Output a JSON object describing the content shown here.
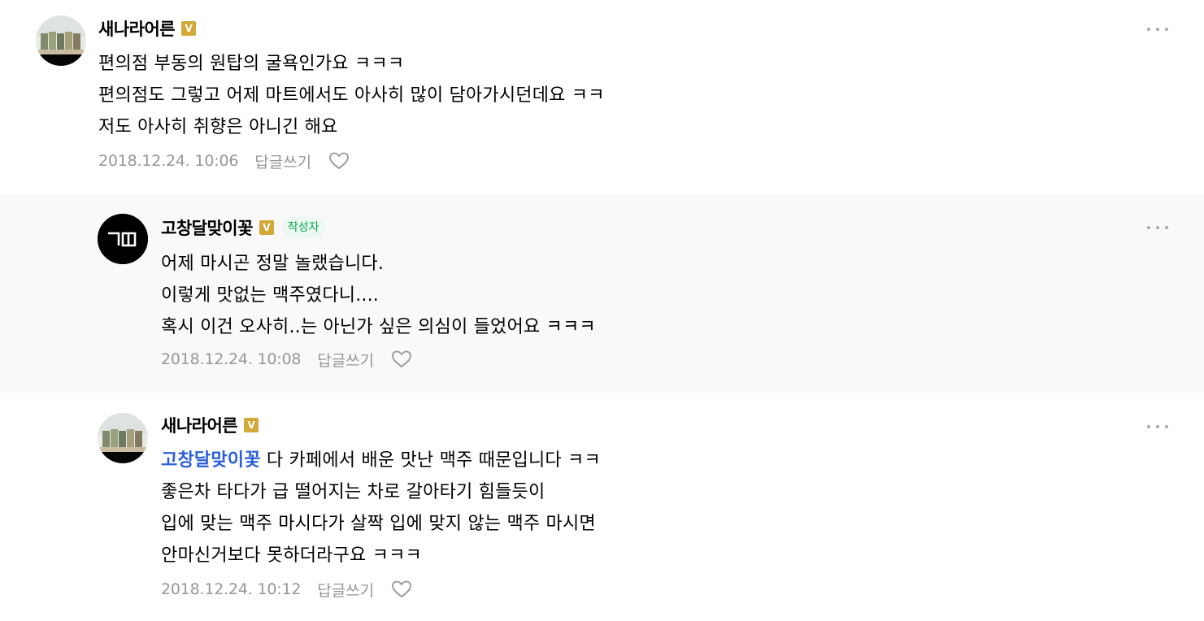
{
  "comments": [
    {
      "nickname": "새나라어른",
      "badge": "V",
      "lines": [
        "편의점 부동의 원탑의 굴욕인가요 ㅋㅋㅋ",
        "편의점도 그렇고 어제 마트에서도 아사히 많이 담아가시던데요 ㅋㅋ",
        "저도 아사히 취향은 아니긴 해요"
      ],
      "date": "2018.12.24. 10:06",
      "reply_label": "답글쓰기",
      "avatar": "photo"
    },
    {
      "nickname": "고창달맞이꽃",
      "badge": "V",
      "author_tag": "작성자",
      "lines": [
        "어제 마시곤 정말 놀랬습니다.",
        "이렇게 맛없는 맥주였다니....",
        "혹시 이건 오사히..는 아닌가 싶은 의심이 들었어요 ㅋㅋㅋ"
      ],
      "date": "2018.12.24. 10:08",
      "reply_label": "답글쓰기",
      "avatar": "logo",
      "avatar_text": "ㄱㄷ"
    },
    {
      "nickname": "새나라어른",
      "badge": "V",
      "mention": "고창달맞이꽃",
      "first_line_rest": " 다 카페에서 배운 맛난 맥주 때문입니다 ㅋㅋ",
      "lines": [
        "좋은차 타다가 급 떨어지는 차로 갈아타기 힘들듯이",
        "입에 맞는 맥주 마시다가 살짝 입에 맞지 않는 맥주 마시면",
        "안마신거보다 못하더라구요 ㅋㅋㅋ"
      ],
      "date": "2018.12.24. 10:12",
      "reply_label": "답글쓰기",
      "avatar": "photo"
    }
  ],
  "icons": {
    "more": "more-dots-icon",
    "like": "heart-icon",
    "badge": "verified-badge-icon"
  },
  "colors": {
    "badge": "#d3a93a",
    "author_tag_text": "#03a94f",
    "author_tag_bg": "#edf8f2",
    "mention": "#2b5fd9",
    "meta": "#979797",
    "reply_bg": "#f9f9fa"
  }
}
